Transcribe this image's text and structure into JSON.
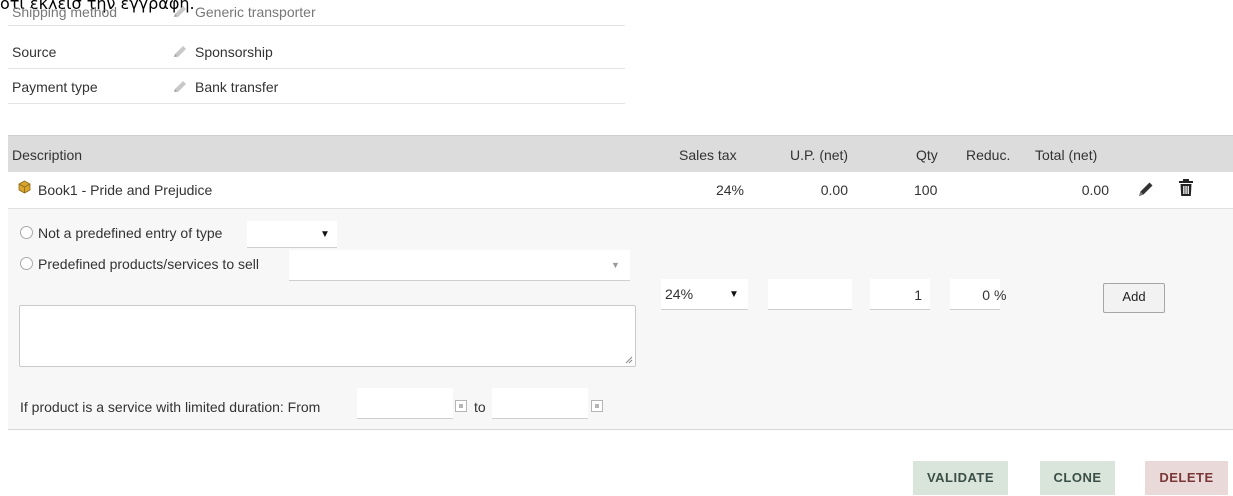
{
  "overlay_text": "ότι έκλεισ την εγγραφή.",
  "properties": [
    {
      "label": "Shipping method",
      "value": "Generic transporter"
    },
    {
      "label": "Source",
      "value": "Sponsorship"
    },
    {
      "label": "Payment type",
      "value": "Bank transfer"
    }
  ],
  "lines_table": {
    "headers": {
      "description": "Description",
      "sales_tax": "Sales tax",
      "up_net": "U.P. (net)",
      "qty": "Qty",
      "reduc": "Reduc.",
      "total_net": "Total (net)"
    },
    "rows": [
      {
        "description": "Book1 - Pride and Prejudice",
        "sales_tax": "24%",
        "up_net": "0.00",
        "qty": "100",
        "reduc": "",
        "total_net": "0.00"
      }
    ]
  },
  "add_line": {
    "free_entry_label": "Not a predefined entry of type",
    "free_entry_type_value": "",
    "predefined_label": "Predefined products/services to sell",
    "predefined_value": "",
    "vat_value": "24%",
    "price_value": "",
    "qty_value": "1",
    "reduc_value": "0",
    "reduc_unit": "%",
    "add_button": "Add",
    "description_value": "",
    "duration_label": "If product is a service with limited duration: From",
    "duration_to_label": "to",
    "date_from_value": "",
    "date_to_value": ""
  },
  "actions": {
    "validate": "VALIDATE",
    "clone": "CLONE",
    "delete": "DELETE"
  },
  "icons": {
    "product": "product-box-icon",
    "edit": "pencil-icon",
    "delete": "trash-icon",
    "property_edit": "pencil-icon"
  },
  "colors": {
    "header_bg": "#dcdcdc",
    "add_area_bg": "#f7f7f7",
    "validate_bg": "#d9e4db",
    "delete_bg": "#ead9d9",
    "delete_text": "#7a3737"
  }
}
